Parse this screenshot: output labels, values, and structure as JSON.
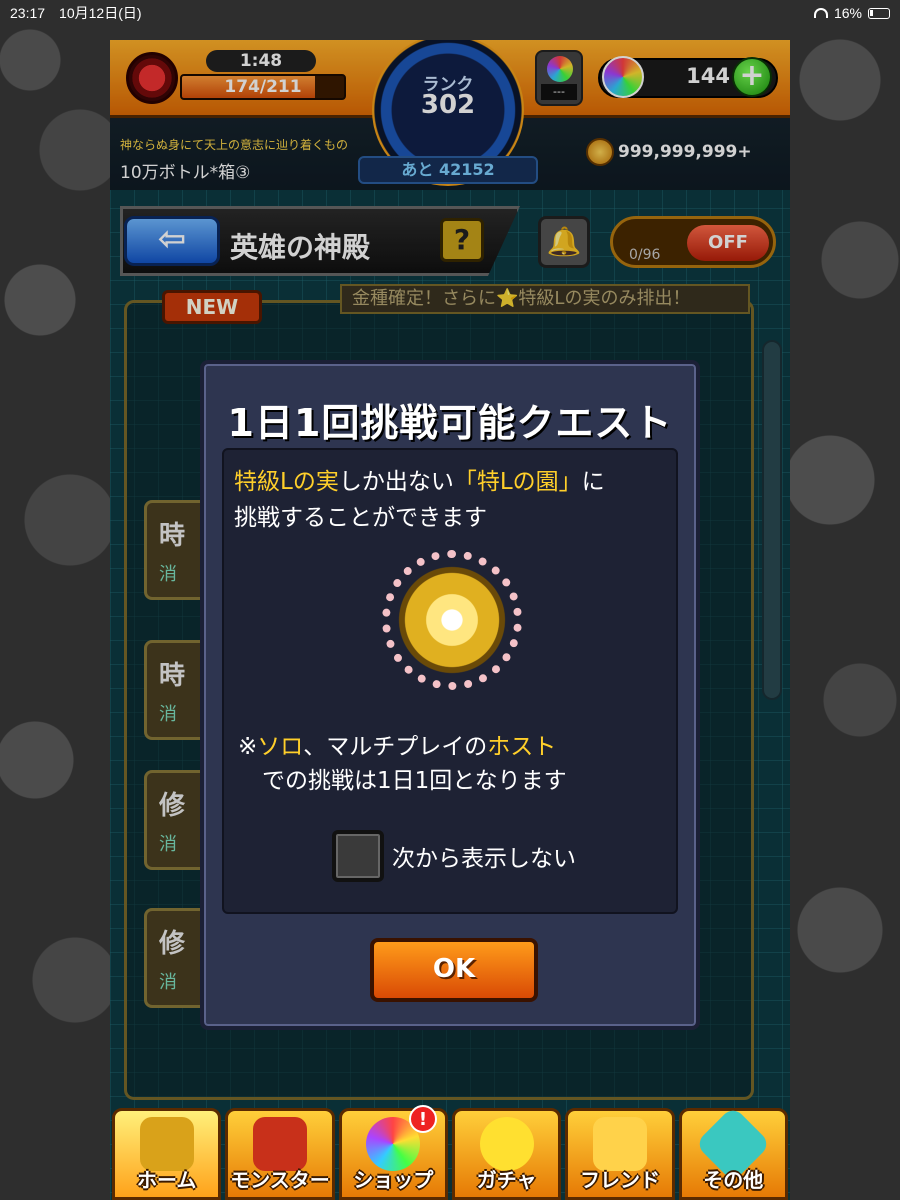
{
  "status_bar": {
    "time": "23:17",
    "date": "10月12日(日)",
    "battery": "16%"
  },
  "header": {
    "stamina_timer": "1:48",
    "stamina": "174/211",
    "stamina_fraction": 0.82,
    "rank_label": "ランク",
    "rank_value": "302",
    "rank_remaining": "あと 42152",
    "title_small": "神ならぬ身にて天上の意志に辿り着くもの",
    "title_main": "10万ボトル*箱③",
    "beacon_value": "---",
    "orb_count": "144",
    "coin_count": "999,999,999+"
  },
  "nav": {
    "back_icon": "⇦",
    "title": "英雄の神殿",
    "help_label": "?",
    "bell_icon": "🔔",
    "toggle_count": "0/96",
    "toggle_label": "OFF"
  },
  "background_list": {
    "new_tag": "NEW",
    "banner": "金種確定！さらに⭐特級Lの実のみ排出！",
    "cards": [
      {
        "title": "時",
        "sub": "消"
      },
      {
        "title": "時",
        "sub": "消"
      },
      {
        "title": "修",
        "sub": "消"
      },
      {
        "title": "修",
        "sub": "消"
      }
    ]
  },
  "modal": {
    "title": "1日1回挑戦可能クエスト",
    "desc_hl1": "特級Lの実",
    "desc_mid1": "しか出ない",
    "desc_hl2": "「特Lの園」",
    "desc_mid2": "に",
    "desc_line2": "挑戦することができます",
    "note_prefix": "※",
    "note_hl1": "ソロ",
    "note_mid": "、マルチプレイの",
    "note_hl2": "ホスト",
    "note_line2": "での挑戦は1日1回となります",
    "checkbox_label": "次から表示しない",
    "checkbox_checked": false,
    "ok_label": "OK"
  },
  "tabs": [
    {
      "label": "ホーム",
      "icon": "home-gate-icon",
      "color": "#d9a21a"
    },
    {
      "label": "モンスター",
      "icon": "monster-dragon-icon",
      "color": "#c8301a"
    },
    {
      "label": "ショップ",
      "icon": "rainbow-orb-icon",
      "color": "#7a5ae0",
      "alert": "!"
    },
    {
      "label": "ガチャ",
      "icon": "gacha-egg-icon",
      "color": "#ffe030"
    },
    {
      "label": "フレンド",
      "icon": "friends-icon",
      "color": "#ffd24a"
    },
    {
      "label": "その他",
      "icon": "other-diamond-icon",
      "color": "#3ac8c0"
    }
  ]
}
